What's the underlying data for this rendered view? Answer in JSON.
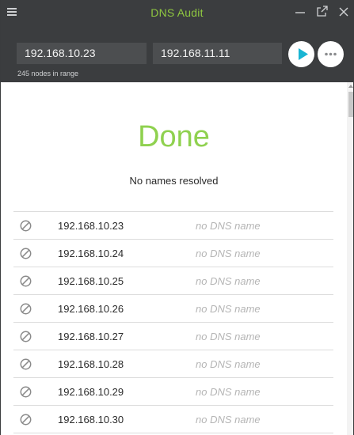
{
  "app": {
    "title": "DNS Audit"
  },
  "toolbar": {
    "start_ip": "192.168.10.23",
    "end_ip": "192.168.11.11",
    "range_note": "245 nodes in range",
    "run_icon": "play-icon",
    "more_icon": "more-horizontal-icon"
  },
  "status": {
    "title": "Done",
    "subtitle": "No names resolved"
  },
  "results": [
    {
      "ip": "192.168.10.23",
      "dns": "no DNS name",
      "icon": "blocked-icon"
    },
    {
      "ip": "192.168.10.24",
      "dns": "no DNS name",
      "icon": "blocked-icon"
    },
    {
      "ip": "192.168.10.25",
      "dns": "no DNS name",
      "icon": "blocked-icon"
    },
    {
      "ip": "192.168.10.26",
      "dns": "no DNS name",
      "icon": "blocked-icon"
    },
    {
      "ip": "192.168.10.27",
      "dns": "no DNS name",
      "icon": "blocked-icon"
    },
    {
      "ip": "192.168.10.28",
      "dns": "no DNS name",
      "icon": "blocked-icon"
    },
    {
      "ip": "192.168.10.29",
      "dns": "no DNS name",
      "icon": "blocked-icon"
    },
    {
      "ip": "192.168.10.30",
      "dns": "no DNS name",
      "icon": "blocked-icon"
    }
  ],
  "colors": {
    "chrome": "#3b3d3f",
    "accent_green": "#8fd14f",
    "title_green": "#8fc740",
    "play_teal": "#19b5d3"
  }
}
